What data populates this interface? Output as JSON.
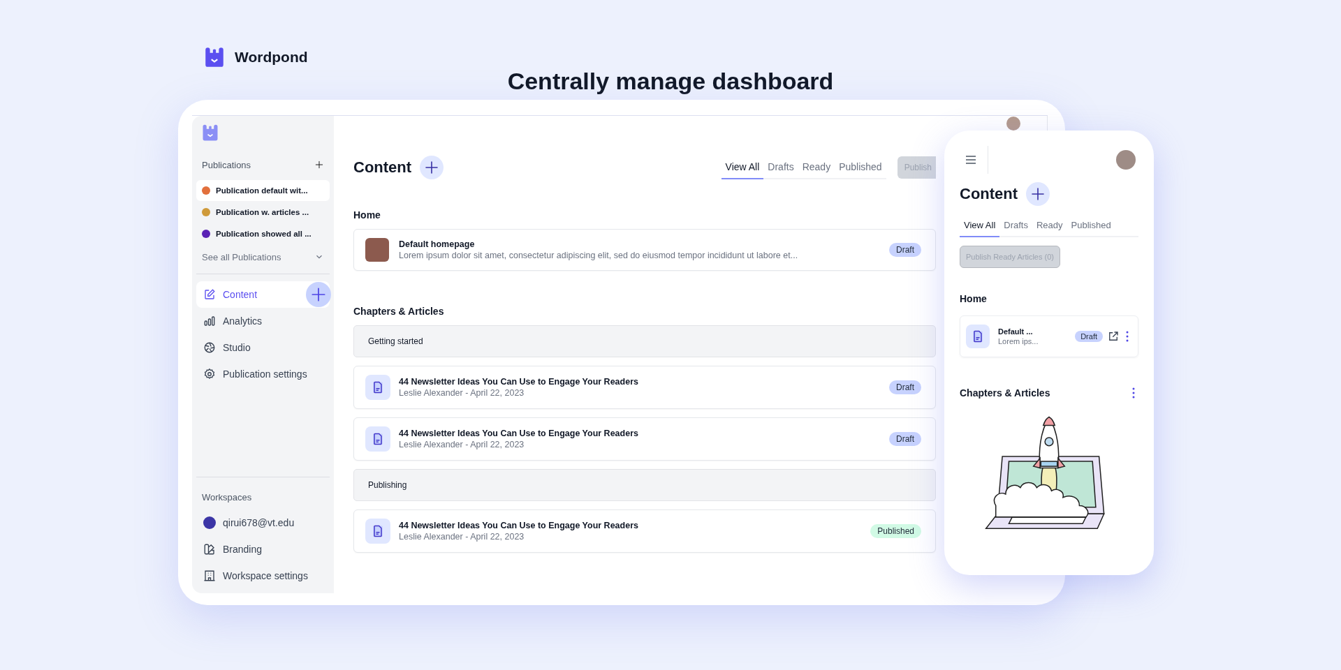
{
  "brand": {
    "name": "Wordpond"
  },
  "headline": "Centrally manage dashboard",
  "desktop": {
    "sidebar": {
      "publications_label": "Publications",
      "publications": [
        {
          "label": "Publication default wit...",
          "color": "#e2703c",
          "selected": true
        },
        {
          "label": "Publication w. articles ...",
          "color": "#cf9a3a",
          "selected": false
        },
        {
          "label": "Publication showed all ...",
          "color": "#5a22b5",
          "selected": false
        }
      ],
      "see_all": "See all Publications",
      "nav": [
        {
          "label": "Content",
          "selected": true
        },
        {
          "label": "Analytics",
          "selected": false
        },
        {
          "label": "Studio",
          "selected": false
        },
        {
          "label": "Publication settings",
          "selected": false
        }
      ],
      "workspaces_label": "Workspaces",
      "workspace": {
        "label": "qirui678@vt.edu",
        "color": "#3b35a6"
      },
      "workspace_nav": [
        {
          "label": "Branding",
          "selected": false
        },
        {
          "label": "Workspace settings",
          "selected": false
        }
      ]
    },
    "main": {
      "title": "Content",
      "tabs": [
        {
          "label": "View All",
          "selected": true
        },
        {
          "label": "Drafts",
          "selected": false
        },
        {
          "label": "Ready",
          "selected": false
        },
        {
          "label": "Published",
          "selected": false
        }
      ],
      "publish_button": {
        "label": "Publish",
        "disabled": true
      },
      "home_label": "Home",
      "home_item": {
        "title": "Default homepage",
        "excerpt": "Lorem ipsum dolor sit amet, consectetur adipiscing elit, sed do eiusmod tempor incididunt ut labore et...",
        "status": "Draft",
        "color": "#c7d2fe"
      },
      "chapters_label": "Chapters & Articles",
      "rows": [
        {
          "kind": "group",
          "label": "Getting started"
        },
        {
          "kind": "article",
          "title": "44 Newsletter Ideas You Can Use to Engage Your Readers",
          "meta": "Leslie Alexander - April 22, 2023",
          "status": "Draft",
          "color": "#c7d2fe"
        },
        {
          "kind": "article",
          "title": "44 Newsletter Ideas You Can Use to Engage Your Readers",
          "meta": "Leslie Alexander - April 22, 2023",
          "status": "Draft",
          "color": "#c7d2fe"
        },
        {
          "kind": "group",
          "label": "Publishing"
        },
        {
          "kind": "article",
          "title": "44 Newsletter Ideas You Can Use to Engage Your Readers",
          "meta": "Leslie Alexander - April 22, 2023",
          "status": "Published",
          "color": "#d1fae5"
        }
      ]
    }
  },
  "mobile": {
    "title": "Content",
    "tabs": [
      {
        "label": "View All",
        "selected": true
      },
      {
        "label": "Drafts",
        "selected": false
      },
      {
        "label": "Ready",
        "selected": false
      },
      {
        "label": "Published",
        "selected": false
      }
    ],
    "publish_button": {
      "label": "Publish Ready Articles (0)",
      "disabled": true
    },
    "home_label": "Home",
    "home_item": {
      "title": "Default ...",
      "excerpt": "Lorem ips...",
      "status": "Draft",
      "color": "#c7d2fe"
    },
    "chapters_label": "Chapters & Articles"
  }
}
